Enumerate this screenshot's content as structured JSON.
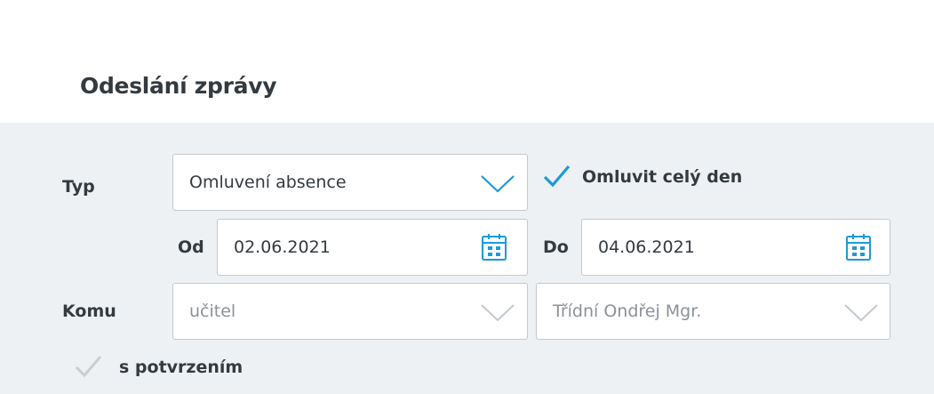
{
  "dialog": {
    "title": "Odeslání zprávy"
  },
  "form": {
    "type_label": "Typ",
    "type_value": "Omluvení absence",
    "whole_day_label": "Omluvit celý den",
    "whole_day_checked": true,
    "from_label": "Od",
    "from_value": "02.06.2021",
    "to_label": "Do",
    "to_value": "04.06.2021",
    "recipient_label": "Komu",
    "recipient_type_value": "učitel",
    "recipient_name_value": "Třídní Ondřej Mgr.",
    "confirmation_label": "s potvrzením",
    "confirmation_checked": true
  },
  "icons": {
    "dropdown": "chevron-down-icon",
    "calendar": "calendar-icon",
    "check": "checkmark-icon"
  },
  "colors": {
    "accent": "#1e9ad6",
    "background": "#eef1f3",
    "text": "#333a40",
    "muted_text": "#8a9299",
    "disabled_check": "#c9ced2"
  }
}
